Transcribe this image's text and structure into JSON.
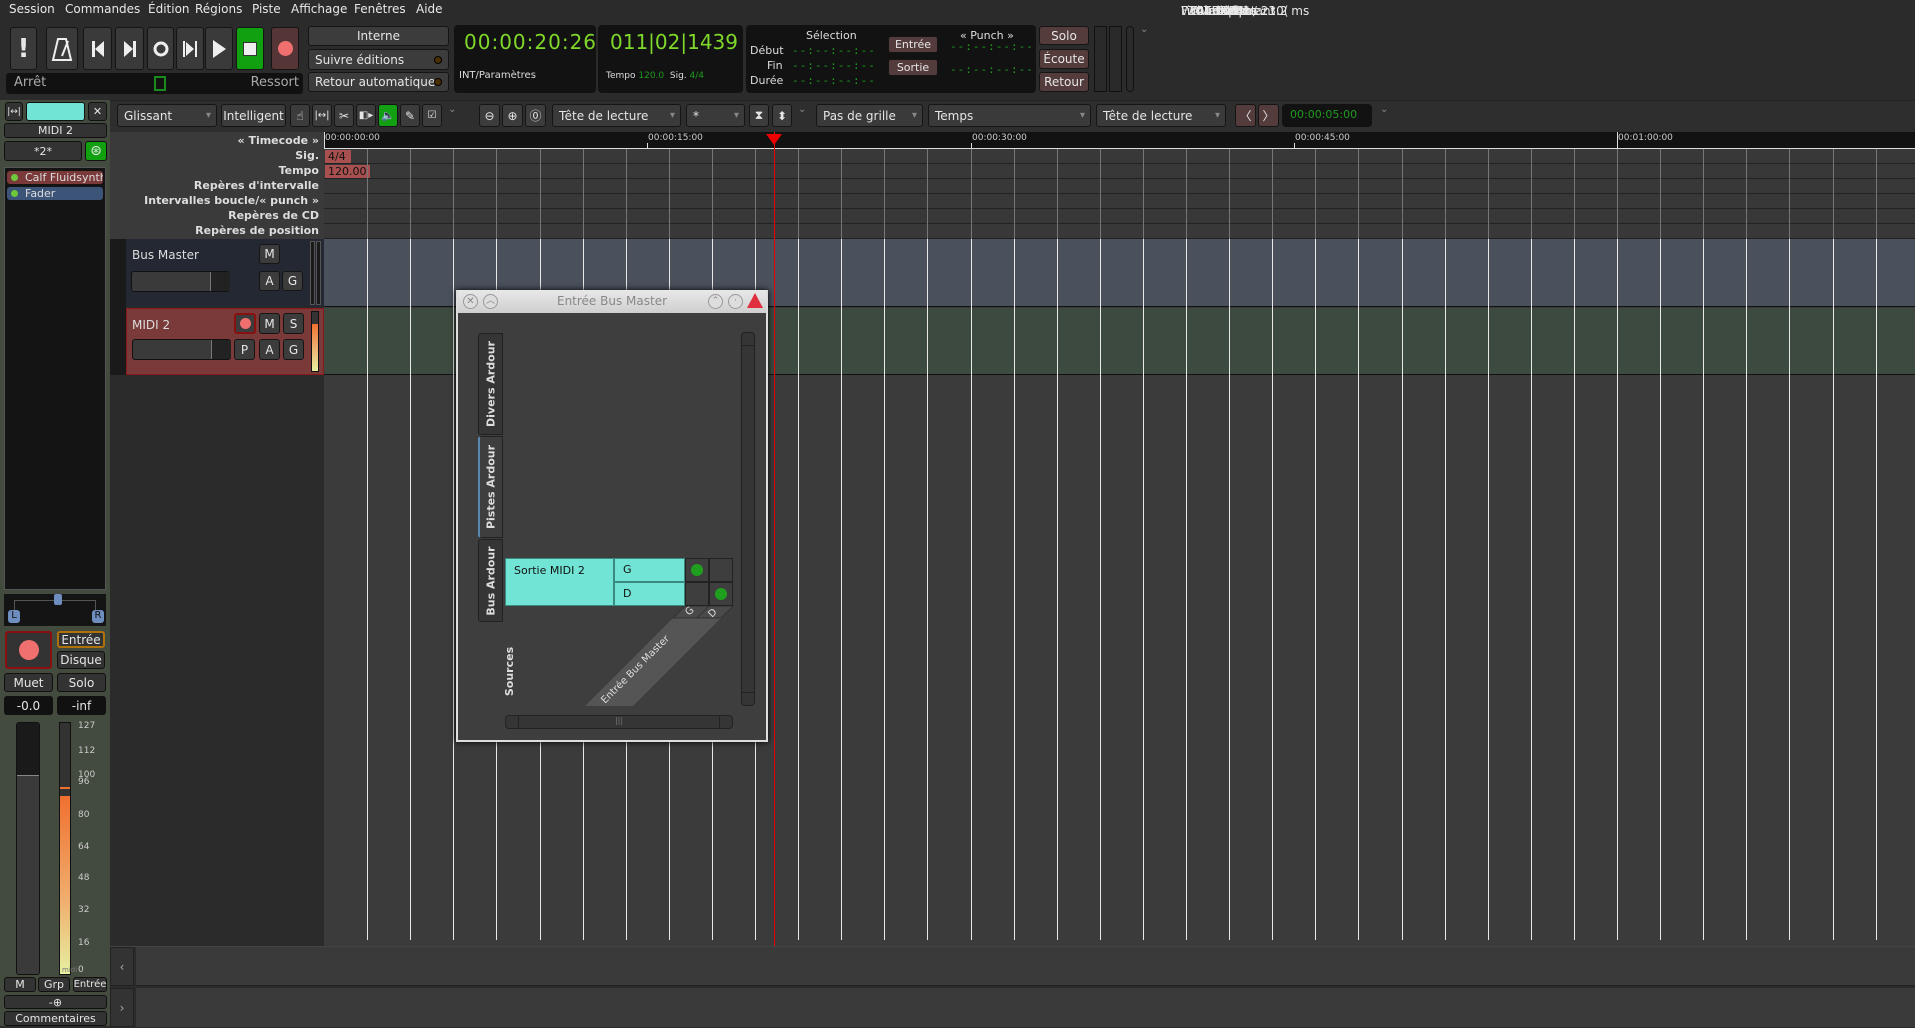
{
  "menu": [
    "Session",
    "Commandes",
    "Édition",
    "Régions",
    "Piste",
    "Affichage",
    "Fenêtres",
    "Aide"
  ],
  "status": {
    "files_label": "Fichiers :",
    "files_value": "WAV 32-flottant",
    "tc_label": "TC :",
    "tc_value": "30",
    "audio_label": "Audio :",
    "audio_value": "44.1 kHz / 23.2 ms",
    "buffers_label": "Tampons :",
    "buffers_value": "l :100% e :10(",
    "dsp_label": "DSP :",
    "dsp_value": "3.4%",
    "disk_label": "Disque :",
    "disk_value": "> 24h",
    "time": "10:01"
  },
  "transport": {
    "state": "Arrêt",
    "mode": "Ressort",
    "sync": "Interne",
    "follow": "Suivre éditions",
    "auto_return": "Retour automatique"
  },
  "clock1": {
    "value": "00:00:20:26",
    "sub": "INT/Paramètres"
  },
  "clock2": {
    "value": "011|02|1439",
    "tempo_label": "Tempo",
    "tempo": "120.0",
    "sig_label": "Sig.",
    "sig": "4/4"
  },
  "selection": {
    "title": "Sélection",
    "punch_title": "« Punch »",
    "start": "Début",
    "end": "Fin",
    "length": "Durée",
    "empty": "--:--:--:--",
    "in": "Entrée",
    "out": "Sortie"
  },
  "monitor": {
    "solo": "Solo",
    "listen": "Écoute",
    "return": "Retour"
  },
  "toolbar": {
    "edit_mode": "Glissant",
    "ripple": "Intelligent",
    "edit_point": "Tête de lecture",
    "zoom_focus": "*",
    "grid": "Pas de grille",
    "grid_type": "Temps",
    "snap_point": "Tête de lecture",
    "nudge_clock": "00:00:05:00"
  },
  "strip": {
    "name": "MIDI 2",
    "comment_btn": "*2*",
    "plugins": [
      "Calf Fluidsynth",
      "Fader"
    ],
    "pan_l": "L",
    "pan_r": "R",
    "input": "Entrée",
    "disk": "Disque",
    "mute": "Muet",
    "solo": "Solo",
    "gain": "-0.0",
    "peak": "-inf",
    "scale": [
      "127",
      "112",
      "100",
      "96",
      "80",
      "64",
      "48",
      "32",
      "16",
      "0"
    ],
    "scale_unit": "midi",
    "m": "M",
    "grp": "Grp",
    "in2": "Entrée",
    "io": "-⊕",
    "comments": "Commentaires"
  },
  "rulers": [
    "« Timecode »",
    "Sig.",
    "Tempo",
    "Repères d'intervalle",
    "Intervalles boucle/« punch »",
    "Repères de CD",
    "Repères de position"
  ],
  "timecode_marks": [
    {
      "t": 0,
      "label": "00:00:00:00"
    },
    {
      "t": 15,
      "label": "00:00:15:00"
    },
    {
      "t": 30,
      "label": "00:00:30:00"
    },
    {
      "t": 45,
      "label": "00:00:45:00"
    },
    {
      "t": 60,
      "label": "00:01:00:00"
    }
  ],
  "meter_marker": "4/4",
  "tempo_marker": "120.00",
  "playhead_seconds": 20.9,
  "tracks": [
    {
      "name": "Bus Master",
      "buttons": [
        "M",
        "A",
        "G"
      ]
    },
    {
      "name": "MIDI 2",
      "buttons": [
        "M",
        "S",
        "P",
        "A",
        "G"
      ]
    }
  ],
  "dialog": {
    "title": "Entrée Bus Master",
    "tabs": [
      "Divers Ardour",
      "Pistes Ardour",
      "Bus Ardour"
    ],
    "sources": "Sources",
    "source_port": "Sortie MIDI 2",
    "channels": [
      "G",
      "D"
    ],
    "dest": "Entrée Bus Master",
    "dest_channels": [
      "G",
      "D"
    ]
  },
  "colors": {
    "accent": "#72e4d5",
    "rec": "#f07070",
    "clock": "#7fd82a"
  }
}
